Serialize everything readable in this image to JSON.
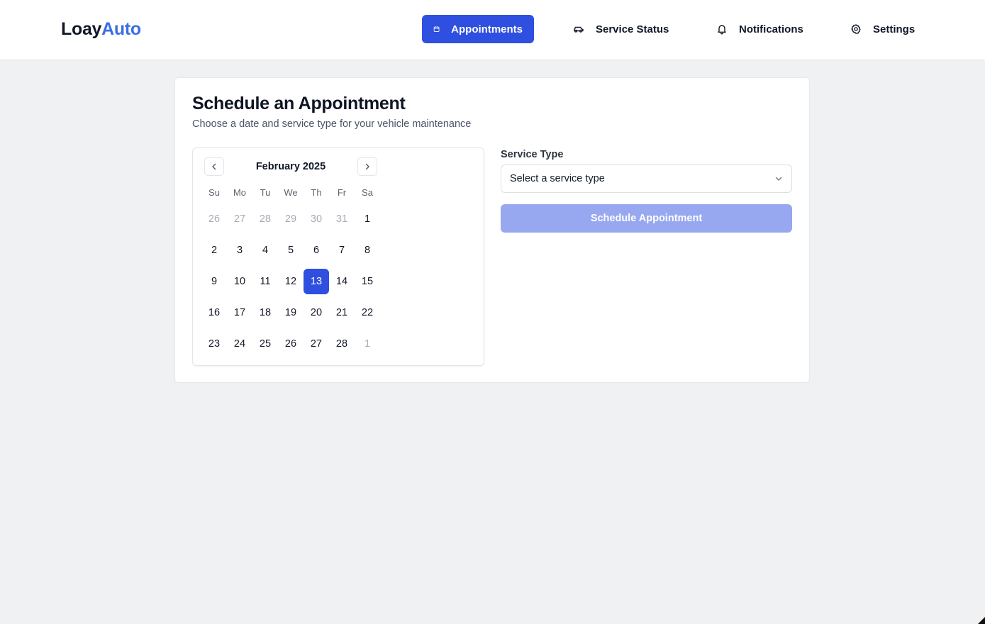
{
  "brand": {
    "part1": "Loay",
    "part2": "Auto",
    "accent": "#3b6ee5"
  },
  "nav": {
    "appointments": {
      "label": "Appointments",
      "icon": "calendar-icon",
      "active": true
    },
    "service_status": {
      "label": "Service Status",
      "icon": "car-icon"
    },
    "notifications": {
      "label": "Notifications",
      "icon": "bell-icon"
    },
    "settings": {
      "label": "Settings",
      "icon": "gear-icon"
    }
  },
  "page": {
    "title": "Schedule an Appointment",
    "subtitle": "Choose a date and service type for your vehicle maintenance"
  },
  "calendar": {
    "month_label": "February 2025",
    "weekdays": [
      "Su",
      "Mo",
      "Tu",
      "We",
      "Th",
      "Fr",
      "Sa"
    ],
    "days": [
      {
        "label": "26",
        "muted": true
      },
      {
        "label": "27",
        "muted": true
      },
      {
        "label": "28",
        "muted": true
      },
      {
        "label": "29",
        "muted": true
      },
      {
        "label": "30",
        "muted": true
      },
      {
        "label": "31",
        "muted": true
      },
      {
        "label": "1"
      },
      {
        "label": "2"
      },
      {
        "label": "3"
      },
      {
        "label": "4"
      },
      {
        "label": "5"
      },
      {
        "label": "6"
      },
      {
        "label": "7"
      },
      {
        "label": "8"
      },
      {
        "label": "9"
      },
      {
        "label": "10"
      },
      {
        "label": "11"
      },
      {
        "label": "12"
      },
      {
        "label": "13",
        "selected": true
      },
      {
        "label": "14"
      },
      {
        "label": "15"
      },
      {
        "label": "16"
      },
      {
        "label": "17"
      },
      {
        "label": "18"
      },
      {
        "label": "19"
      },
      {
        "label": "20"
      },
      {
        "label": "21"
      },
      {
        "label": "22"
      },
      {
        "label": "23"
      },
      {
        "label": "24"
      },
      {
        "label": "25"
      },
      {
        "label": "26"
      },
      {
        "label": "27"
      },
      {
        "label": "28"
      },
      {
        "label": "1",
        "muted": true
      }
    ],
    "selected_color": "#2f4fe0"
  },
  "service_type": {
    "label": "Service Type",
    "placeholder": "Select a service type"
  },
  "actions": {
    "schedule_label": "Schedule Appointment",
    "schedule_disabled": true,
    "schedule_color": "#98a8f0"
  }
}
